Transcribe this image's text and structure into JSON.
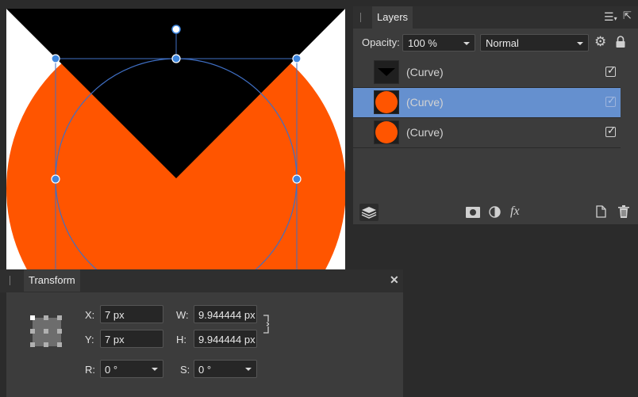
{
  "canvas": {
    "colors": {
      "background": "#ffffff",
      "orange": "#ff5500",
      "black": "#000000",
      "guide": "#3f6fc4",
      "handle": "#3f87df"
    }
  },
  "layers_panel": {
    "tab_label": "Layers",
    "opacity_label": "Opacity:",
    "opacity_value": "100 %",
    "blend_mode": "Normal",
    "layers": [
      {
        "name": "(Curve)",
        "thumbnail": "black-triangle",
        "visible": true,
        "selected": false
      },
      {
        "name": "(Curve)",
        "thumbnail": "orange-circle",
        "visible": true,
        "selected": true
      },
      {
        "name": "(Curve)",
        "thumbnail": "orange-circle",
        "visible": true,
        "selected": false
      }
    ],
    "footer_icons": [
      "layers-stack-icon",
      "mask-icon",
      "adjustment-icon",
      "fx-icon",
      "new-layer-icon",
      "trash-icon"
    ],
    "colors": {
      "selected_row": "#6590cf"
    }
  },
  "transform_panel": {
    "tab_label": "Transform",
    "x_label": "X:",
    "x_value": "7 px",
    "y_label": "Y:",
    "y_value": "7 px",
    "w_label": "W:",
    "w_value": "9.944444 px",
    "h_label": "H:",
    "h_value": "9.944444 px",
    "r_label": "R:",
    "r_value": "0 °",
    "s_label": "S:",
    "s_value": "0 °"
  }
}
